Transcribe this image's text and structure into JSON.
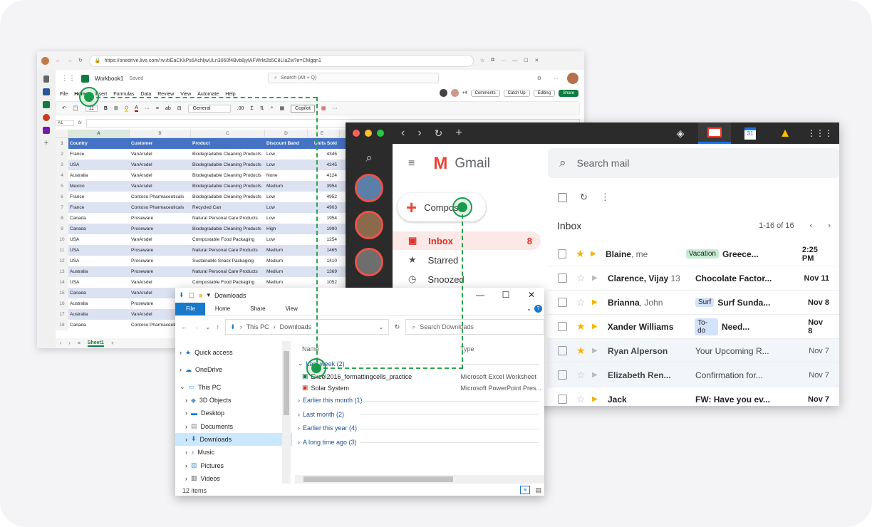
{
  "excel": {
    "url": "https://onedrive.live.com/:w:/t/EaCKkPs6AchljwULn3060f4Bvb8jylAFWrkt2b5C8LIaZw?e=CMgqn1",
    "app_name": "Workbook1",
    "saved_status": "Saved",
    "search_placeholder": "Search (Alt + Q)",
    "menu": [
      "File",
      "Home",
      "Insert",
      "Formulas",
      "Data",
      "Review",
      "View",
      "Automate",
      "Help"
    ],
    "presence_count": "+4",
    "comments": "Comments",
    "catch_up": "Catch Up",
    "editing": "Editing",
    "share": "Share",
    "font_size": "11",
    "number_format": "General",
    "copilot": "Copilot",
    "cell_ref": "A1",
    "fx": "fx",
    "columns": [
      "A",
      "B",
      "C",
      "D",
      "E"
    ],
    "header": [
      "Country",
      "Customer",
      "Product",
      "Discount Band",
      "Units Sold"
    ],
    "rows": [
      [
        "France",
        "VanArsdel",
        "Biodegradable Cleaning Products",
        "Low",
        "4345"
      ],
      [
        "USA",
        "VanArsdel",
        "Biodegradable Cleaning Products",
        "Low",
        "4245"
      ],
      [
        "Australia",
        "VanArsdel",
        "Biodegradable Cleaning Products",
        "None",
        "4124"
      ],
      [
        "Mexico",
        "VanArsdel",
        "Biodegradable Cleaning Products",
        "Medium",
        "3954"
      ],
      [
        "France",
        "Contoso Pharmaceuticals",
        "Biodegradable Cleaning Products",
        "Low",
        "4952"
      ],
      [
        "France",
        "Contoso Pharmaceuticals",
        "Recycled Can",
        "Low",
        "4903"
      ],
      [
        "Canada",
        "Proseware",
        "Natural Personal Care Products",
        "Low",
        "1954"
      ],
      [
        "Canada",
        "Proseware",
        "Biodegradable Cleaning Products",
        "High",
        "1990"
      ],
      [
        "USA",
        "VanArsdel",
        "Compostable Food Packaging",
        "Low",
        "1254"
      ],
      [
        "USA",
        "Proseware",
        "Natural Personal Care Products",
        "Medium",
        "1465"
      ],
      [
        "USA",
        "Proseware",
        "Sustainable Snack Packaging",
        "Medium",
        "1410"
      ],
      [
        "Australia",
        "Proseware",
        "Natural Personal Care Products",
        "Medium",
        "1369"
      ],
      [
        "USA",
        "VanArsdel",
        "Compostable Food Packaging",
        "Medium",
        "1052"
      ],
      [
        "Canada",
        "VanArsdel",
        "",
        "",
        ""
      ],
      [
        "Australia",
        "Proseware",
        "",
        "",
        ""
      ],
      [
        "Australia",
        "VanArsdel",
        "",
        "",
        ""
      ],
      [
        "Canada",
        "Contoso Pharmaceuticals",
        "",
        "",
        ""
      ]
    ],
    "sheet_tab": "Sheet1"
  },
  "gmail": {
    "logo_text": "Gmail",
    "search_placeholder": "Search mail",
    "compose": "Compose",
    "nav": [
      {
        "label": "Inbox",
        "count": "8"
      },
      {
        "label": "Starred",
        "count": ""
      },
      {
        "label": "Snoozed",
        "count": ""
      }
    ],
    "calendar_day": "31",
    "inbox_title": "Inbox",
    "pagination": "1-16 of 16",
    "emails": [
      {
        "from": "Blaine",
        "from_extra": ", me",
        "label": "Vacation",
        "subject": "Greece...",
        "time": "2:25 PM"
      },
      {
        "from": "Clarence, Vijay",
        "from_extra": " 13",
        "label": "",
        "subject": "Chocolate Factor...",
        "time": "Nov 11"
      },
      {
        "from": "Brianna",
        "from_extra": ", John",
        "label": "Surf",
        "subject": "Surf Sunda...",
        "time": "Nov 8"
      },
      {
        "from": "Xander Williams",
        "from_extra": "",
        "label": "To-do",
        "subject": "Need...",
        "time": "Nov 8"
      },
      {
        "from": "Ryan Alperson",
        "from_extra": "",
        "label": "",
        "subject": "Your Upcoming R...",
        "time": "Nov 7"
      },
      {
        "from": "Elizabeth Ren...",
        "from_extra": "",
        "label": "",
        "subject": "Confirmation for...",
        "time": "Nov 7"
      },
      {
        "from": "Jack",
        "from_extra": "",
        "label": "",
        "subject": "FW: Have you ev...",
        "time": "Nov 7"
      }
    ],
    "label_colors": {
      "Vacation": "#c6ebd2",
      "Surf": "#d3e3fd",
      "To-do": "#d3e3fd"
    }
  },
  "explorer": {
    "title": "Downloads",
    "tabs": [
      "File",
      "Home",
      "Share",
      "View"
    ],
    "breadcrumb": [
      "This PC",
      "Downloads"
    ],
    "search_placeholder": "Search Downloads",
    "nav": [
      "Quick access",
      "OneDrive",
      "This PC",
      "3D Objects",
      "Desktop",
      "Documents",
      "Downloads",
      "Music",
      "Pictures",
      "Videos"
    ],
    "col_name": "Name",
    "col_type": "Type",
    "groups": [
      "Last week (2)",
      "Earlier this month (1)",
      "Last month (2)",
      "Earlier this year (4)",
      "A long time ago (3)"
    ],
    "files": [
      {
        "name": "Excel2016_formattingcells_practice",
        "type": "Microsoft Excel Worksheet"
      },
      {
        "name": "Solar System",
        "type": "Microsoft PowerPoint Pres..."
      }
    ],
    "status": "12 items"
  }
}
